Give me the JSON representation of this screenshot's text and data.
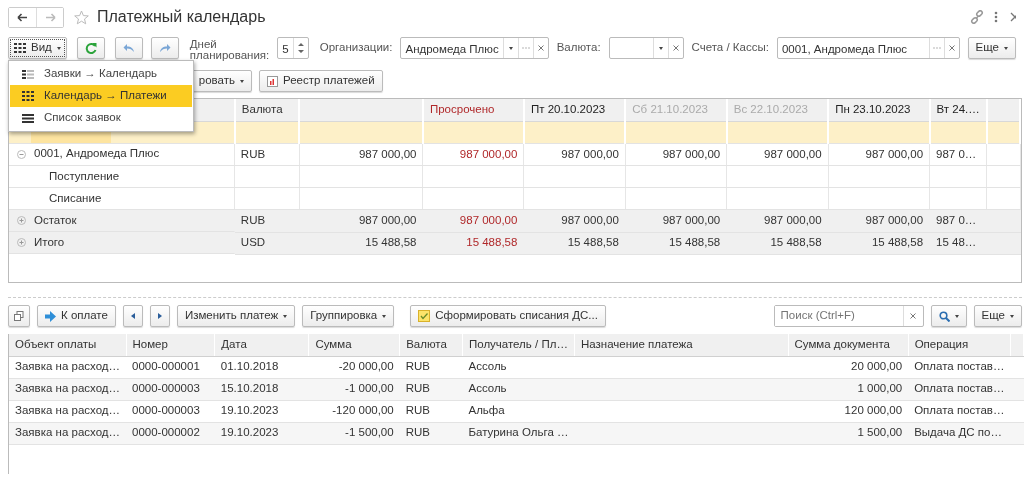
{
  "window": {
    "title": "Платежный календарь"
  },
  "filters": {
    "view_button": "Вид",
    "days_label": "Дней планирования:",
    "days_value": "5",
    "org_label": "Организации:",
    "org_value": "Андромеда Плюс",
    "currency_label": "Валюта:",
    "accounts_label": "Счета / Кассы:",
    "accounts_value": "0001, Андромеда Плюс",
    "more_button": "Еще"
  },
  "actions": {
    "partial_button": "ровать",
    "register_button": "Реестр платежей"
  },
  "view_menu": [
    {
      "label": "Заявки → Календарь",
      "selected": false
    },
    {
      "label": "Календарь → Платежи",
      "selected": true
    },
    {
      "label": "Список заявок",
      "selected": false
    }
  ],
  "calendar": {
    "currency_header": "Валюта",
    "overdue_header": "Просрочено",
    "days": [
      {
        "label": "Пт 20.10.2023",
        "weekend": false
      },
      {
        "label": "Сб 21.10.2023",
        "weekend": true
      },
      {
        "label": "Вс 22.10.2023",
        "weekend": true
      },
      {
        "label": "Пн 23.10.2023",
        "weekend": false
      },
      {
        "label": "Вт 24.…",
        "weekend": false
      }
    ],
    "rows": [
      {
        "kind": "highlight"
      },
      {
        "kind": "group",
        "name": "0001, Андромеда Плюс",
        "expanded": true,
        "currency": "RUB",
        "total": "987 000,00",
        "overdue": "987 000,00",
        "days": [
          "987 000,00",
          "987 000,00",
          "987 000,00",
          "987 000,00",
          "987 0…"
        ]
      },
      {
        "kind": "sub",
        "name": "Поступление"
      },
      {
        "kind": "sub",
        "name": "Списание"
      },
      {
        "kind": "summary",
        "name": "Остаток",
        "expanded": false,
        "currency": "RUB",
        "total": "987 000,00",
        "overdue": "987 000,00",
        "days": [
          "987 000,00",
          "987 000,00",
          "987 000,00",
          "987 000,00",
          "987 0…"
        ]
      },
      {
        "kind": "summary",
        "name": "Итого",
        "expanded": false,
        "currency": "USD",
        "total": "15 488,58",
        "overdue": "15 488,58",
        "days": [
          "15 488,58",
          "15 488,58",
          "15 488,58",
          "15 488,58",
          "15 48…"
        ]
      }
    ]
  },
  "payments_toolbar": {
    "pay_button": "К оплате",
    "change_button": "Изменить платеж",
    "grouping_button": "Группировка",
    "generate_button": "Сформировать списания ДС...",
    "search_placeholder": "Поиск (Ctrl+F)",
    "more_button": "Еще"
  },
  "payments": {
    "columns": [
      "Объект оплаты",
      "Номер",
      "Дата",
      "Сумма",
      "Валюта",
      "Получатель / Пл…",
      "Назначение платежа",
      "Сумма документа",
      "Операция"
    ],
    "rows": [
      {
        "object": "Заявка на расход…",
        "number": "0000-000001",
        "date": "01.10.2018",
        "amount": "-20 000,00",
        "currency": "RUB",
        "recipient": "Ассоль",
        "document_amount": "20 000,00",
        "operation": "Оплата постав…"
      },
      {
        "object": "Заявка на расход…",
        "number": "0000-000003",
        "date": "15.10.2018",
        "amount": "-1 000,00",
        "currency": "RUB",
        "recipient": "Ассоль",
        "document_amount": "1 000,00",
        "operation": "Оплата постав…"
      },
      {
        "object": "Заявка на расход…",
        "number": "0000-000003",
        "date": "19.10.2023",
        "amount": "-120 000,00",
        "currency": "RUB",
        "recipient": "Альфа",
        "document_amount": "120 000,00",
        "operation": "Оплата постав…"
      },
      {
        "object": "Заявка на расход…",
        "number": "0000-000002",
        "date": "19.10.2023",
        "amount": "-1 500,00",
        "currency": "RUB",
        "recipient": "Батурина Ольга …",
        "document_amount": "1 500,00",
        "operation": "Выдача ДС по…"
      }
    ]
  }
}
